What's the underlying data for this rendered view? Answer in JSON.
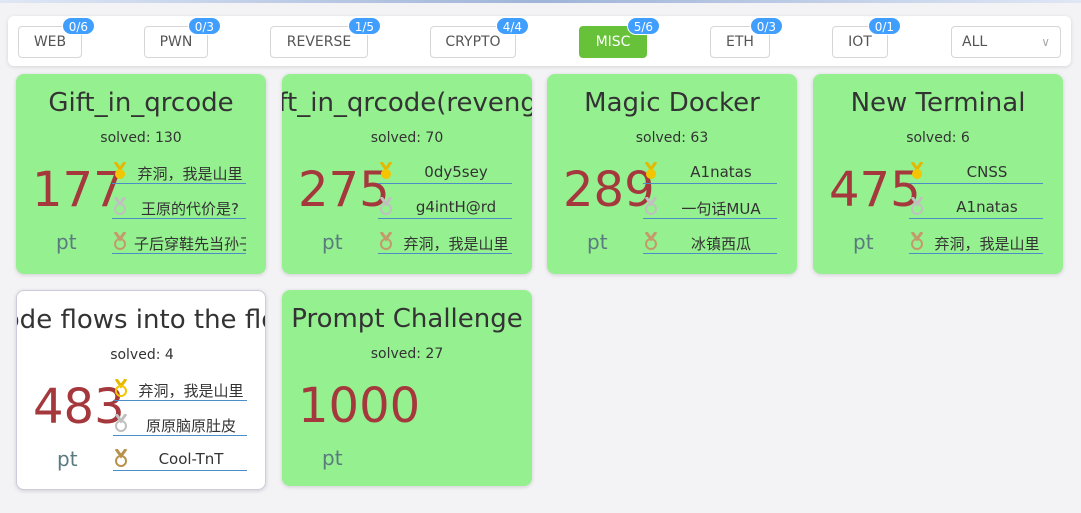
{
  "filter": {
    "categories": [
      {
        "label": "WEB",
        "badge": "0/6"
      },
      {
        "label": "PWN",
        "badge": "0/3"
      },
      {
        "label": "REVERSE",
        "badge": "1/5"
      },
      {
        "label": "CRYPTO",
        "badge": "4/4"
      },
      {
        "label": "MISC",
        "badge": "5/6"
      },
      {
        "label": "ETH",
        "badge": "0/3"
      },
      {
        "label": "IOT",
        "badge": "0/1"
      }
    ],
    "select_value": "ALL"
  },
  "challenges": [
    {
      "title": "Gift_in_qrcode",
      "solves": "solved: 130",
      "points": "177",
      "unit": "pt",
      "ranks": [
        "弃洞，我是山里",
        "王原的代价是?",
        "子后穿鞋先当孙子"
      ]
    },
    {
      "title": "Gift_in_qrcode(revenge)",
      "solves": "solved: 70",
      "points": "275",
      "unit": "pt",
      "ranks": [
        "0dy5sey",
        "g4intH@rd",
        "弃洞，我是山里"
      ]
    },
    {
      "title": "Magic Docker",
      "solves": "solved: 63",
      "points": "289",
      "unit": "pt",
      "ranks": [
        "A1natas",
        "一句话MUA",
        "冰镇西瓜"
      ]
    },
    {
      "title": "New Terminal",
      "solves": "solved: 6",
      "points": "475",
      "unit": "pt",
      "ranks": [
        "CNSS",
        "A1natas",
        "弃洞，我是山里"
      ]
    },
    {
      "title": "Code flows into the flow",
      "solves": "solved: 4",
      "points": "483",
      "unit": "pt",
      "ranks": [
        "弃洞，我是山里",
        "原原脑原肚皮",
        "Cool-TnT"
      ]
    },
    {
      "title": "Prompt Challenge",
      "solves": "solved: 27",
      "points": "1000",
      "unit": "pt",
      "ranks": []
    }
  ],
  "colors": {
    "solved_bg": "#95f090",
    "active_category": "#67c23a",
    "badge": "#409eff",
    "points": "#a5383c"
  },
  "medal_icons": [
    "gold-medal-icon",
    "silver-medal-icon",
    "bronze-medal-icon"
  ]
}
